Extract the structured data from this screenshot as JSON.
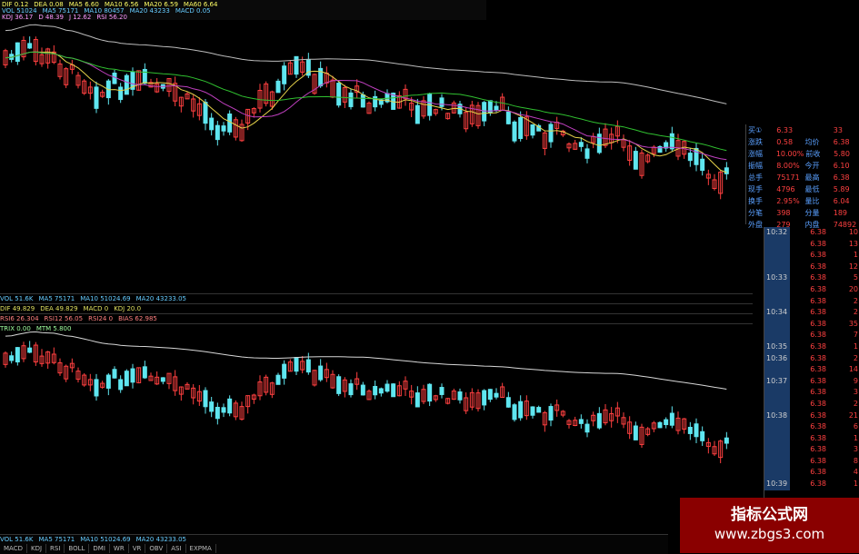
{
  "topbar": {
    "line1": [
      "DIF 0.12",
      "DEA 0.08",
      "MA5 6.60",
      "MA10 6.56",
      "MA20 6.59",
      "MA60 6.64"
    ],
    "line2": [
      "VOL 51024",
      "MA5 75171",
      "MA10 80457",
      "MA20 43233",
      "MACD 0.05"
    ],
    "line3": [
      "KDJ 36.17",
      "D 48.39",
      "J 12.62",
      "RSI 56.20"
    ]
  },
  "indicator_rows": [
    [
      "VOL 51.6K",
      "MA5 75171",
      "MA10 51024.69",
      "MA20 43233.05"
    ],
    [
      "DIF 49.829",
      "DEA 49.829",
      "MACD 0",
      "KDJ 20.0"
    ],
    [
      "RSI6 26.304",
      "RSI12 56.05",
      "RSI24 0",
      "BIAS 62.985"
    ],
    [
      "TRIX 0.00",
      "MTM 5.800"
    ]
  ],
  "bottom_row": [
    "VOL 51.6K",
    "MA5 75171",
    "MA10 51024.69",
    "MA20 43233.05"
  ],
  "bottom_tabs": [
    "MACD",
    "KDJ",
    "RSI",
    "BOLL",
    "DMI",
    "WR",
    "VR",
    "OBV",
    "ASI",
    "EXPMA"
  ],
  "quote_panel": {
    "rows": [
      {
        "label": "买①",
        "value": "6.33",
        "label2": "",
        "value2": "33"
      },
      {
        "label": "涨跌",
        "value": "0.58",
        "label2": "均价",
        "value2": "6.38"
      },
      {
        "label": "涨幅",
        "value": "10.00%",
        "label2": "前收",
        "value2": "5.80"
      },
      {
        "label": "振幅",
        "value": "8.00%",
        "label2": "今开",
        "value2": "6.10"
      },
      {
        "label": "总手",
        "value": "75171",
        "label2": "最高",
        "value2": "6.38"
      },
      {
        "label": "现手",
        "value": "4796",
        "label2": "最低",
        "value2": "5.89"
      },
      {
        "label": "换手",
        "value": "2.95%",
        "label2": "量比",
        "value2": "6.04"
      },
      {
        "label": "分笔",
        "value": "398",
        "label2": "分量",
        "value2": "189"
      },
      {
        "label": "外盘",
        "value": "279",
        "label2": "内盘",
        "value2": "74892"
      }
    ]
  },
  "trade_list": [
    {
      "time": "10:32",
      "price": "6.38",
      "vol": "10"
    },
    {
      "time": "",
      "price": "6.38",
      "vol": "13"
    },
    {
      "time": "",
      "price": "6.38",
      "vol": "1"
    },
    {
      "time": "",
      "price": "6.38",
      "vol": "12"
    },
    {
      "time": "10:33",
      "price": "6.38",
      "vol": "5"
    },
    {
      "time": "",
      "price": "6.38",
      "vol": "20"
    },
    {
      "time": "",
      "price": "6.38",
      "vol": "2"
    },
    {
      "time": "10:34",
      "price": "6.38",
      "vol": "2"
    },
    {
      "time": "",
      "price": "6.38",
      "vol": "35"
    },
    {
      "time": "",
      "price": "6.38",
      "vol": "7"
    },
    {
      "time": "10:35",
      "price": "6.38",
      "vol": "1"
    },
    {
      "time": "10:36",
      "price": "6.38",
      "vol": "2"
    },
    {
      "time": "",
      "price": "6.38",
      "vol": "14"
    },
    {
      "time": "10:37",
      "price": "6.38",
      "vol": "9"
    },
    {
      "time": "",
      "price": "6.38",
      "vol": "3"
    },
    {
      "time": "",
      "price": "6.38",
      "vol": "2"
    },
    {
      "time": "10:38",
      "price": "6.38",
      "vol": "21"
    },
    {
      "time": "",
      "price": "6.38",
      "vol": "6"
    },
    {
      "time": "",
      "price": "6.38",
      "vol": "1"
    },
    {
      "time": "",
      "price": "6.38",
      "vol": "3"
    },
    {
      "time": "",
      "price": "6.38",
      "vol": "8"
    },
    {
      "time": "",
      "price": "6.38",
      "vol": "4"
    },
    {
      "time": "10:39",
      "price": "6.38",
      "vol": "1"
    }
  ],
  "watermark": {
    "title": "指标公式网",
    "url": "www.zbgs3.com"
  },
  "colors": {
    "up": "#ff4040",
    "down": "#5fe6f0",
    "ma_yellow": "#e6d24a",
    "ma_white": "#d8d8d8",
    "ma_purple": "#c040c0",
    "ma_green": "#30c030",
    "ma_gray": "#bcbcbc"
  }
}
